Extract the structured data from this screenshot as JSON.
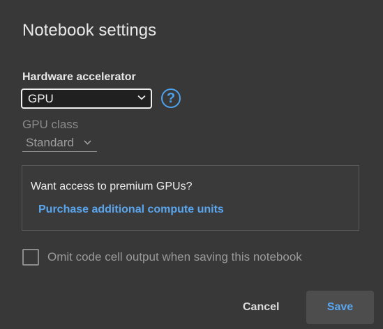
{
  "dialog": {
    "title": "Notebook settings",
    "hardware_accelerator": {
      "label": "Hardware accelerator",
      "value": "GPU",
      "help_icon": "question-circle-icon"
    },
    "gpu_class": {
      "label": "GPU class",
      "value": "Standard"
    },
    "premium": {
      "question": "Want access to premium GPUs?",
      "link": "Purchase additional compute units"
    },
    "omit_output": {
      "label": "Omit code cell output when saving this notebook",
      "checked": false
    },
    "buttons": {
      "cancel": "Cancel",
      "save": "Save"
    },
    "colors": {
      "accent": "#5aa6ee",
      "background": "#383838"
    }
  }
}
